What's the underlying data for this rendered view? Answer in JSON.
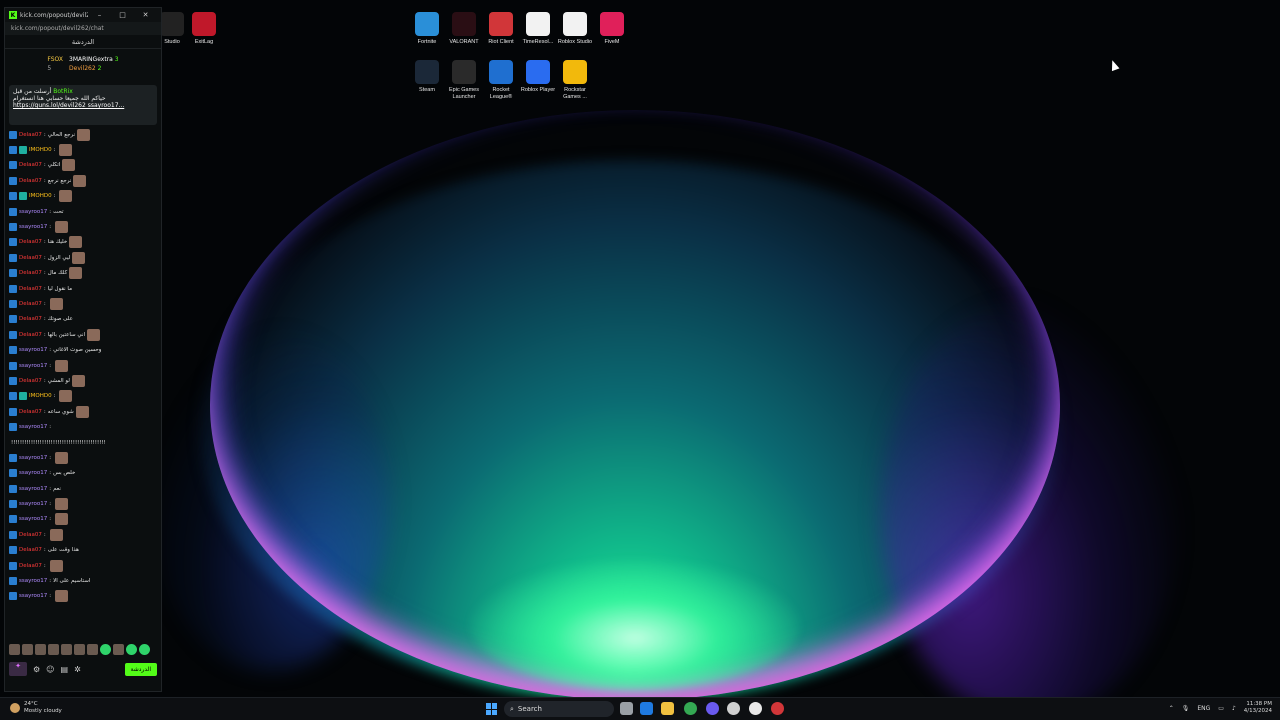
{
  "chat_window": {
    "title": "kick.com/popout/devil262/c...",
    "url": "kick.com/popout/devil262/chat",
    "header": "الدردشة",
    "top_gifters": [
      {
        "name": "FSOX",
        "count": "5"
      },
      {
        "name": "3MARINGextra",
        "count": "3"
      },
      {
        "name": "Devil262",
        "count": "2"
      }
    ],
    "pinned": {
      "label": "أرسلت من قبل",
      "author": "BotRix",
      "line1": "حياكم الله جميعا حسابي هنا انستغرام",
      "line2": "https://guns.lol/devil262 ssayroo17..."
    },
    "messages": [
      {
        "user": "Delaa07",
        "color": "red",
        "text": "نرجع الحالي",
        "emote": true
      },
      {
        "user": "IMOHD0",
        "color": "gold",
        "text": "",
        "emote": true
      },
      {
        "user": "Delaa07",
        "color": "red",
        "text": "اتكلي",
        "emote": true
      },
      {
        "user": "Delaa07",
        "color": "red",
        "text": "نرجع نرجع",
        "emote": true
      },
      {
        "user": "IMOHD0",
        "color": "gold",
        "text": "",
        "emote": true
      },
      {
        "user": "ssayroo17",
        "color": "purple",
        "text": "تحت",
        "emote": false
      },
      {
        "user": "ssayroo17",
        "color": "purple",
        "text": "",
        "emote": true
      },
      {
        "user": "Delaa07",
        "color": "red",
        "text": "خليك هنا",
        "emote": true
      },
      {
        "user": "Delaa07",
        "color": "red",
        "text": "ليي الزول",
        "emote": true
      },
      {
        "user": "Delaa07",
        "color": "red",
        "text": "كلك مال",
        "emote": true
      },
      {
        "user": "Delaa07",
        "color": "red",
        "text": "ما نقول ليا",
        "emote": false
      },
      {
        "user": "Delaa07",
        "color": "red",
        "text": "",
        "emote": true
      },
      {
        "user": "Delaa07",
        "color": "red",
        "text": "على صوتك",
        "emote": false
      },
      {
        "user": "Delaa07",
        "color": "red",
        "text": "اني ساعتين بالها",
        "emote": true
      },
      {
        "user": "ssayroo17",
        "color": "purple",
        "text": "وحسين صوت الاغاني",
        "emote": false
      },
      {
        "user": "ssayroo17",
        "color": "purple",
        "text": "",
        "emote": true
      },
      {
        "user": "Delaa07",
        "color": "red",
        "text": "لو المشي",
        "emote": true
      },
      {
        "user": "IMOHD0",
        "color": "gold",
        "text": "",
        "emote": true
      },
      {
        "user": "Delaa07",
        "color": "red",
        "text": "شوي ساعه",
        "emote": true
      },
      {
        "user": "ssayroo17",
        "color": "purple",
        "text": "",
        "emote": false
      },
      {
        "user": "",
        "color": "purple",
        "text": "!!!!!!!!!!!!!!!!!!!!!!!!!!!!!!!!!!!!!!!!!!!",
        "emote": false
      },
      {
        "user": "ssayroo17",
        "color": "purple",
        "text": "",
        "emote": true
      },
      {
        "user": "ssayroo17",
        "color": "purple",
        "text": "خلص بس",
        "emote": false
      },
      {
        "user": "ssayroo17",
        "color": "purple",
        "text": "نعم",
        "emote": false
      },
      {
        "user": "ssayroo17",
        "color": "purple",
        "text": "",
        "emote": true
      },
      {
        "user": "ssayroo17",
        "color": "purple",
        "text": "",
        "emote": true
      },
      {
        "user": "Delaa07",
        "color": "red",
        "text": "",
        "emote": true
      },
      {
        "user": "Delaa07",
        "color": "red",
        "text": "هذا وقت على",
        "emote": false
      },
      {
        "user": "Delaa07",
        "color": "red",
        "text": "",
        "emote": true
      },
      {
        "user": "ssayroo17",
        "color": "purple",
        "text": "استاسيم على الا",
        "emote": false
      },
      {
        "user": "ssayroo17",
        "color": "purple",
        "text": "",
        "emote": true
      }
    ],
    "send_label": "الدردشة"
  },
  "desktop_icons": [
    {
      "label": "Studio",
      "icon": "studio-icon",
      "color": "#222222"
    },
    {
      "label": "ExitLag",
      "icon": "exitlag-icon",
      "color": "#c0182a"
    },
    {
      "label": "Fortnite",
      "icon": "fortnite-icon",
      "color": "#2a8fd8"
    },
    {
      "label": "VALORANT",
      "icon": "valorant-icon",
      "color": "#2a0e14"
    },
    {
      "label": "Riot Client",
      "icon": "riot-icon",
      "color": "#d13639"
    },
    {
      "label": "TimeResol...",
      "icon": "clock-icon",
      "color": "#f2f2f2"
    },
    {
      "label": "Roblox Studio",
      "icon": "roblox-studio-icon",
      "color": "#f2f2f2"
    },
    {
      "label": "FiveM",
      "icon": "fivem-icon",
      "color": "#e0205a"
    },
    {
      "label": "Steam",
      "icon": "steam-icon",
      "color": "#1b2838"
    },
    {
      "label": "Epic Games Launcher",
      "icon": "epic-icon",
      "color": "#2a2a2a"
    },
    {
      "label": "Rocket League®",
      "icon": "rocket-league-icon",
      "color": "#1f6fd0"
    },
    {
      "label": "Roblox Player",
      "icon": "roblox-icon",
      "color": "#2a6cf0"
    },
    {
      "label": "Rockstar Games ...",
      "icon": "rockstar-icon",
      "color": "#f2b90c"
    }
  ],
  "taskbar": {
    "weather_temp": "24°C",
    "weather_text": "Mostly cloudy",
    "search_placeholder": "Search",
    "language": "ENG",
    "time": "11:38 PM",
    "date": "4/13/2024"
  }
}
